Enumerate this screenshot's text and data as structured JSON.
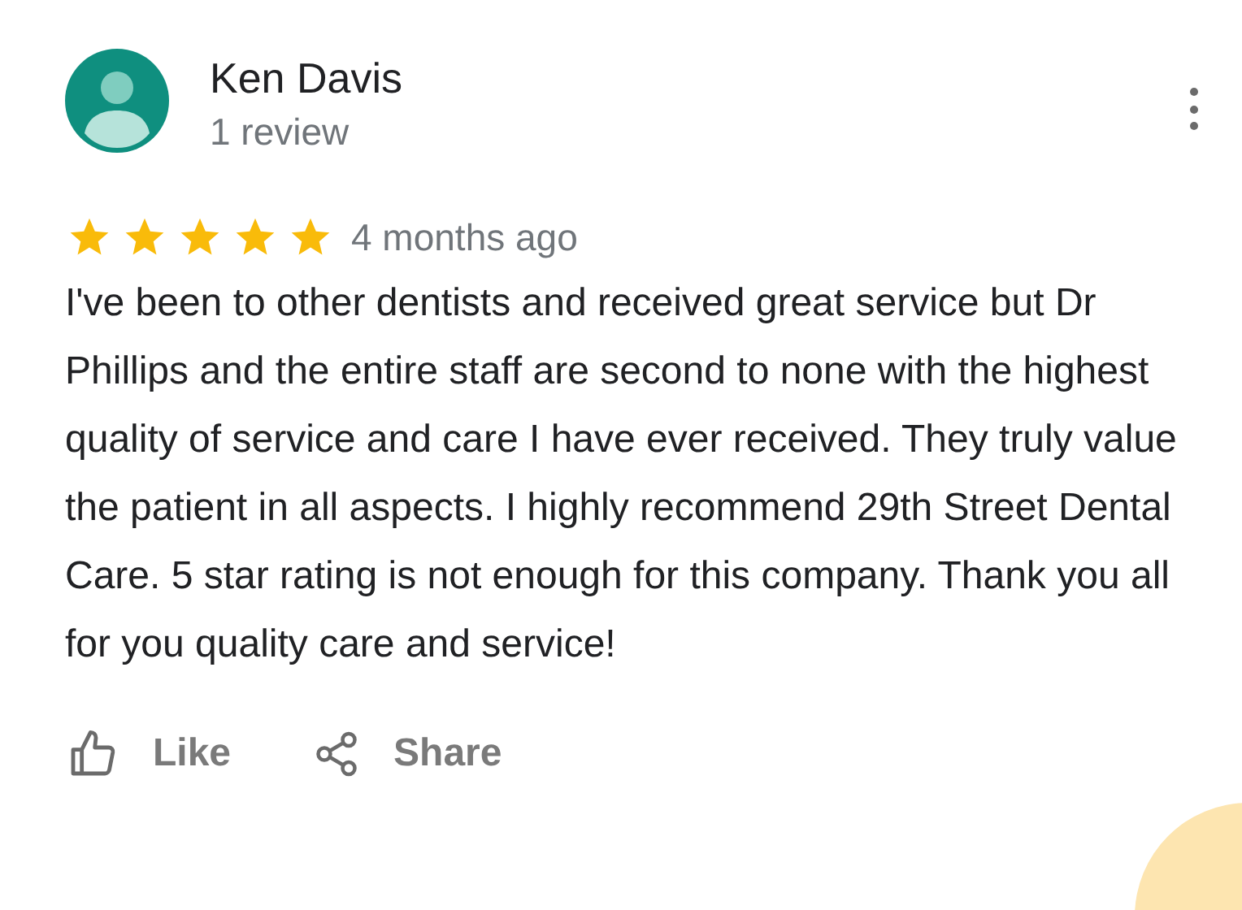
{
  "reviewer": {
    "name": "Ken Davis",
    "review_count": "1 review"
  },
  "review": {
    "stars": 5,
    "time": "4 months ago",
    "text": "I've been to other dentists and received great service but Dr Phillips and the entire staff are second to none with the highest quality of service and care I have ever received. They truly value the patient in all aspects. I highly recommend 29th Street Dental Care. 5 star rating is not enough for this company. Thank you all for you quality care and service!"
  },
  "actions": [
    {
      "kind": "like",
      "label": "Like"
    },
    {
      "kind": "share",
      "label": "Share"
    }
  ]
}
